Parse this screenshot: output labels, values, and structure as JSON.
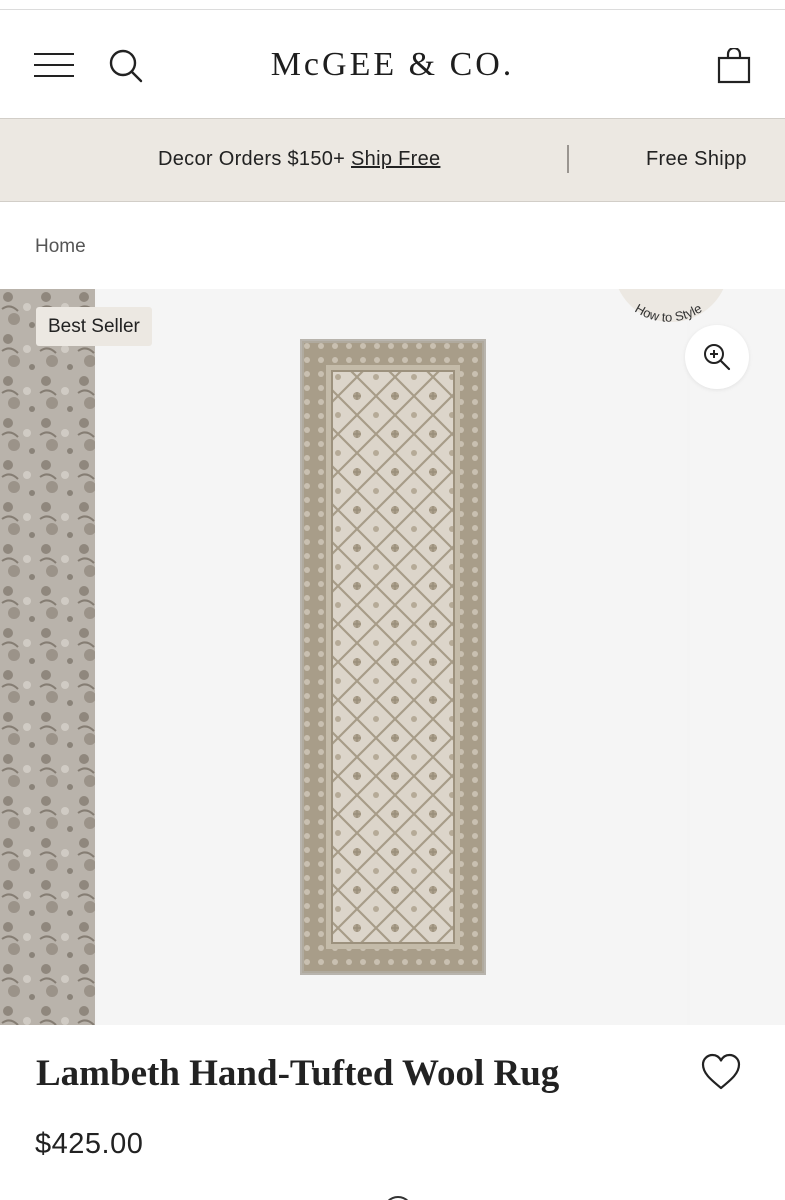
{
  "header": {
    "logo": "McGEE & CO.",
    "menu_icon": "hamburger-icon",
    "search_icon": "search-icon",
    "cart_icon": "shopping-bag-icon"
  },
  "promo": {
    "message_1_text": "Decor Orders $150+ ",
    "message_1_link": "Ship Free",
    "message_2_text": "Free Shipp"
  },
  "breadcrumb": {
    "home": "Home"
  },
  "gallery": {
    "badge": "Best Seller",
    "how_to_style": "How to Style",
    "zoom_icon": "zoom-in-icon"
  },
  "product": {
    "title": "Lambeth Hand-Tufted Wool Rug",
    "price": "$425.00",
    "wishlist_icon": "heart-icon"
  },
  "colors": {
    "promo_bg": "#ece8e2",
    "rug_field": "#d8d0c4",
    "rug_border": "#a59a86",
    "gallery_bg": "#f5f5f5"
  }
}
